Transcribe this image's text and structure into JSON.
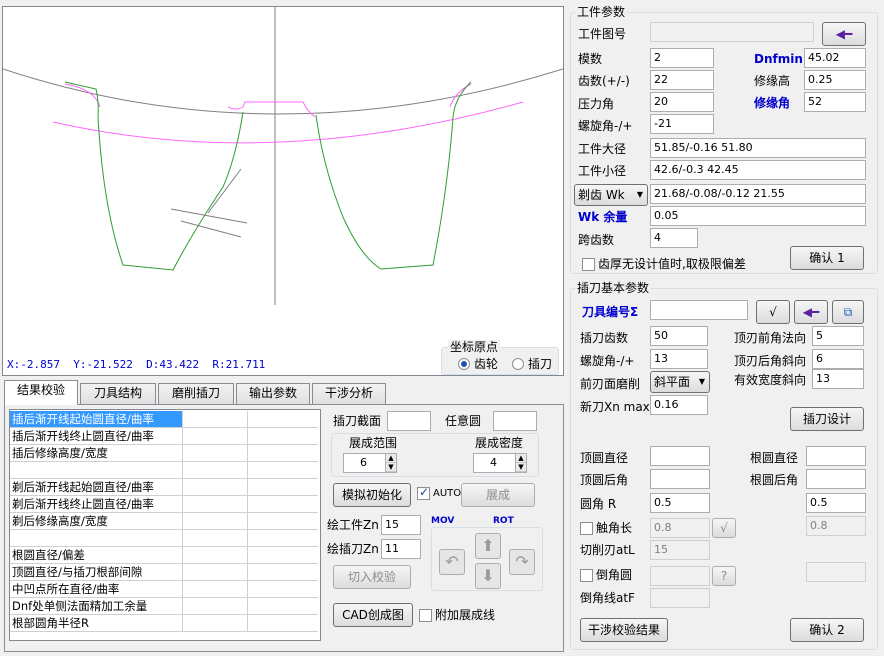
{
  "canvas": {
    "coords": {
      "x": "X:-2.857",
      "y": "Y:-21.522",
      "d": "D:43.422",
      "r": "R:21.711"
    },
    "origin_group": "坐标原点",
    "origin_options": [
      "齿轮",
      "插刀"
    ],
    "origin_selected": "齿轮",
    "colors": {
      "gray": "#7f7f7f",
      "magenta": "#ff66ff",
      "green": "#2e9e2e"
    }
  },
  "tabs": [
    "结果校验",
    "刀具结构",
    "磨削插刀",
    "输出参数",
    "干涉分析"
  ],
  "active_tab": "结果校验",
  "result_list": [
    "插后渐开线起始圆直径/曲率",
    "插后渐开线终止圆直径/曲率",
    "插后修缘高度/宽度",
    "",
    "剃后渐开线起始圆直径/曲率",
    "剃后渐开线终止圆直径/曲率",
    "剃后修缘高度/宽度",
    "",
    "根圆直径/偏差",
    "顶圆直径/与插刀根部间隙",
    "中凹点所在直径/曲率",
    "Dnf处单侧法面精加工余量",
    "根部圆角半径R"
  ],
  "check_panel": {
    "section_label": "插刀截面",
    "section_value": "",
    "any_circle_label": "任意圆",
    "any_circle_value": "",
    "range_label": "展成范围",
    "range_value": "6",
    "density_label": "展成密度",
    "density_value": "4",
    "sim_init_btn": "模拟初始化",
    "auto_label": "AUTO",
    "generate_btn": "展成",
    "draw_workpiece_label": "绘工件Zn",
    "draw_workpiece_value": "15",
    "draw_cutter_label": "绘插刀Zn",
    "draw_cutter_value": "11",
    "cut_check_btn": "切入校验",
    "mov_label": "MOV",
    "rot_label": "ROT",
    "cad_btn": "CAD创成图",
    "add_gen_line_label": "附加展成线"
  },
  "workpiece": {
    "group_title": "工件参数",
    "drawing_no_label": "工件图号",
    "drawing_no_value": "",
    "module_label": "模数",
    "module_value": "2",
    "teeth_label": "齿数(+/-)",
    "teeth_value": "22",
    "pressure_label": "压力角",
    "pressure_value": "20",
    "helix_label": "螺旋角-/+",
    "helix_value": "-21",
    "dnfmin_label": "Dnfmin",
    "dnfmin_value": "45.02",
    "tip_relief_h_label": "修缘高",
    "tip_relief_h_value": "0.25",
    "tip_relief_ang_label": "修缘角",
    "tip_relief_ang_value": "52",
    "major_dia_label": "工件大径",
    "major_dia_value": "51.85/-0.16  51.80",
    "minor_dia_label": "工件小径",
    "minor_dia_value": "42.6/-0.3  42.45",
    "wk_select": "剃齿 Wk",
    "wk_value": "21.68/-0.08/-0.12  21.55",
    "wk_allow_label": "Wk 余量",
    "wk_allow_value": "0.05",
    "span_label": "跨齿数",
    "span_value": "4",
    "limit_dev_label": "齿厚无设计值时,取极限偏差",
    "confirm1_btn": "确认 1"
  },
  "cutter": {
    "group_title": "插刀基本参数",
    "tool_no_label": "刀具编号Σ",
    "tool_no_value": "",
    "teeth_label": "插刀齿数",
    "teeth_value": "50",
    "helix_label": "螺旋角-/+",
    "helix_value": "13",
    "face_grind_label": "前刃面磨削",
    "face_grind_value": "斜平面",
    "new_xn_label": "新刀Xn max",
    "new_xn_value": "0.16",
    "top_rake_label": "顶刃前角法向",
    "top_rake_value": "5",
    "top_clear_label": "顶刃后角斜向",
    "top_clear_value": "6",
    "eff_width_label": "有效宽度斜向",
    "eff_width_value": "13",
    "design_btn": "插刀设计",
    "tip_dia_label": "顶圆直径",
    "tip_dia_value": "",
    "root_dia_label": "根圆直径",
    "root_dia_value": "",
    "tip_back_label": "顶圆后角",
    "tip_back_value": "",
    "root_back_label": "根圆后角",
    "root_back_value": "",
    "fillet_label": "圆角 R",
    "fillet_value": "0.5",
    "fillet_value2": "0.5",
    "protub_label": "触角长",
    "protub_value": "0.8",
    "protub_value2": "0.8",
    "chip_label": "切削刃atL",
    "chip_value": "15",
    "chamfer_label": "倒角圆",
    "chamfer_line_label": "倒角线atF",
    "interf_btn": "干涉校验结果",
    "confirm2_btn": "确认 2"
  }
}
